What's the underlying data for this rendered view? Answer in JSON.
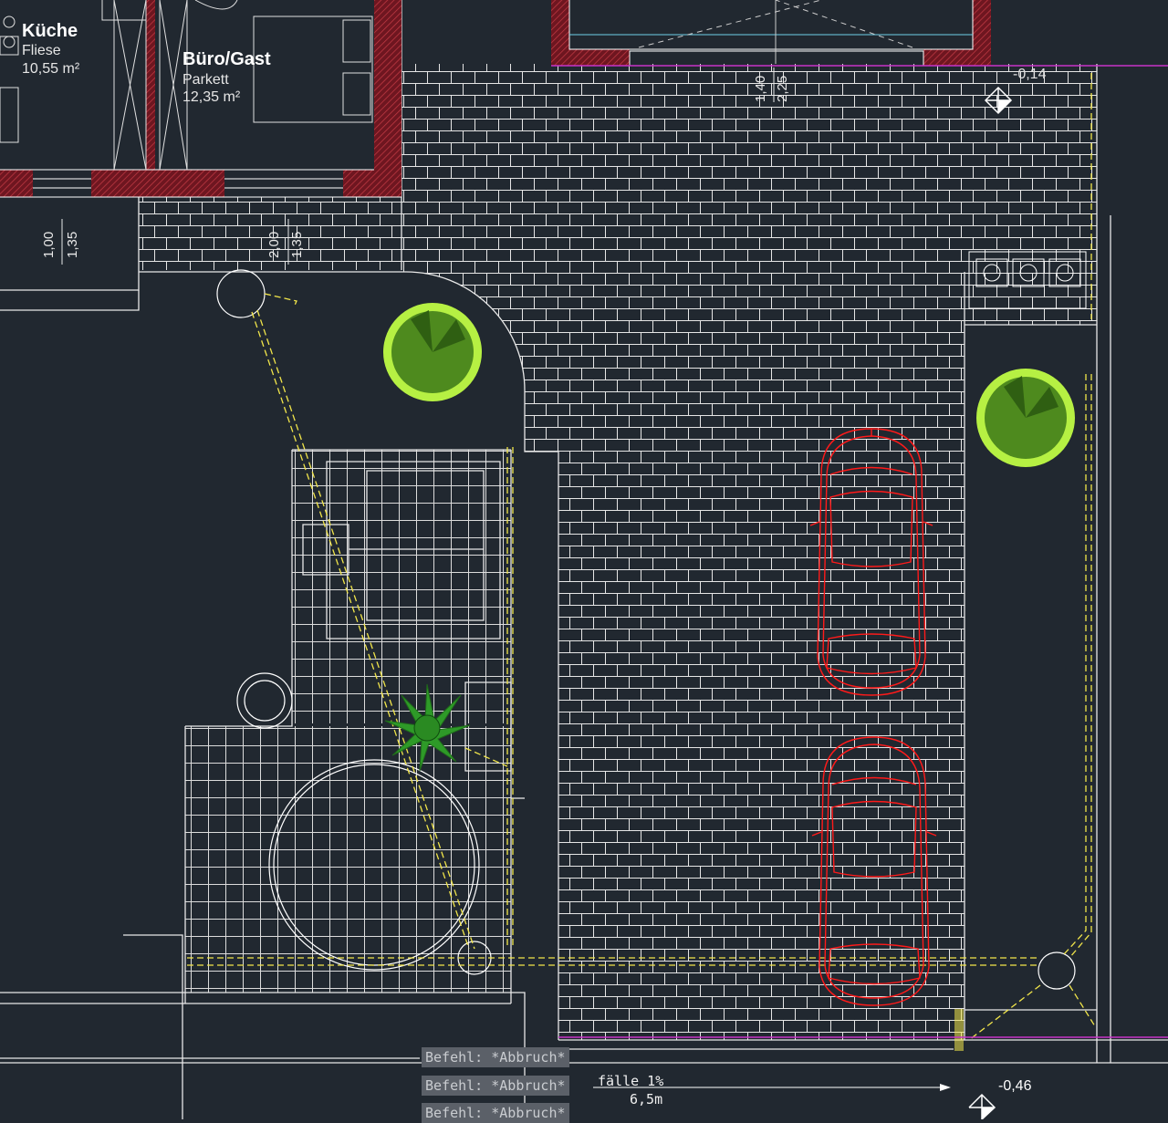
{
  "rooms": [
    {
      "name": "Küche",
      "material": "Fliese",
      "area": "10,55 m²"
    },
    {
      "name": "Büro/Gast",
      "material": "Parkett",
      "area": "12,35 m²"
    }
  ],
  "dimensions": {
    "window_left_top": "1,00",
    "window_left_bottom": "1,35",
    "window_mid_top": "2,00",
    "window_mid_bottom": "1,35",
    "garage_top": "1,40",
    "garage_bottom": "2,25",
    "level_top": "-0,14",
    "level_bottom": "-0,46"
  },
  "annotations": {
    "slope": "fälle 1%",
    "length": "6,5m"
  },
  "command_line": {
    "lines": [
      "Befehl: *Abbruch*",
      "Befehl: *Abbruch*",
      "Befehl: *Abbruch*"
    ]
  },
  "colors": {
    "background": "#212830",
    "lines": "#ffffff",
    "walls": "#8b1b24",
    "cars": "#ff1a1a",
    "trees": "#5aa022",
    "tree_rim": "#b6f043",
    "drainage": "#f2e64a",
    "property_line": "#c832c8"
  }
}
